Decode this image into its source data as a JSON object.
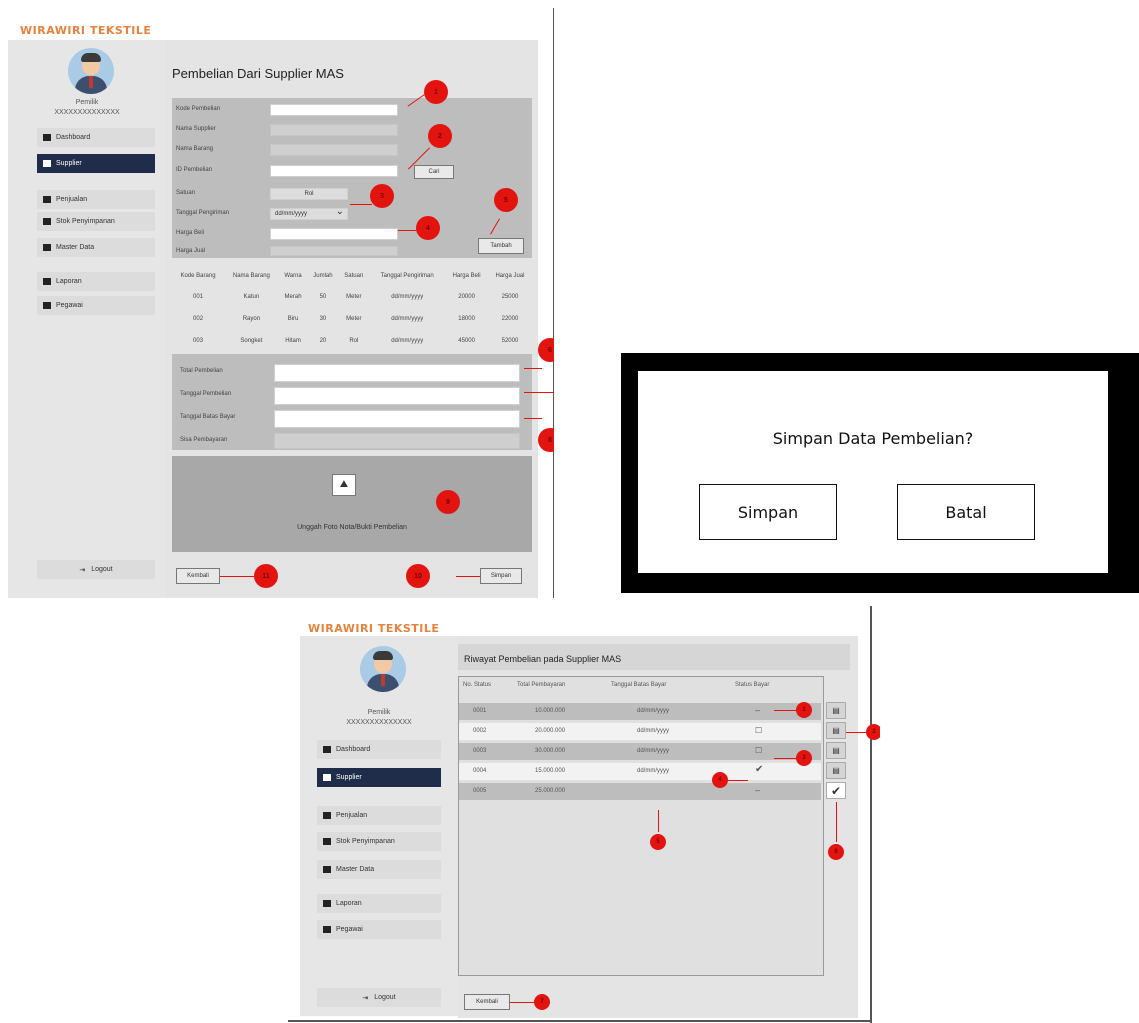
{
  "brand": "WIRAWIRI TEKSTILE",
  "user": {
    "name": "Pemilik",
    "id": "XXXXXXXXXXXXXX"
  },
  "nav": [
    "Dashboard",
    "Supplier",
    "Penjualan",
    "Stok Penyimpanan",
    "Master Data",
    "Laporan",
    "Pegawai"
  ],
  "logout_label": "Logout",
  "form_screen": {
    "title": "Pembelian Dari Supplier MAS",
    "fields": [
      "Kode Pembelian",
      "Nama Supplier",
      "Nama Barang",
      "ID Pembelian",
      "Satuan",
      "Tanggal Pengiriman",
      "Harga Beli",
      "Harga Jual"
    ],
    "cari_label": "Cari",
    "satuan_value": "Rol",
    "date_value": "dd/mm/yyyy",
    "tambah_label": "Tambah",
    "table_headers": [
      "Kode Barang",
      "Nama Barang",
      "Warna",
      "Jumlah",
      "Satuan",
      "Tanggal Pengiriman",
      "Harga Beli",
      "Harga Jual"
    ],
    "table_rows": [
      [
        "001",
        "Katun",
        "Merah",
        "50",
        "Meter",
        "dd/mm/yyyy",
        "20000",
        "25000"
      ],
      [
        "002",
        "Rayon",
        "Biru",
        "30",
        "Meter",
        "dd/mm/yyyy",
        "18000",
        "22000"
      ],
      [
        "003",
        "Songket",
        "Hitam",
        "20",
        "Rol",
        "dd/mm/yyyy",
        "45000",
        "52000"
      ]
    ],
    "payment_fields": [
      "Total Pembelian",
      "Tanggal Pembelian",
      "Tanggal Batas Bayar",
      "Sisa Pembayaran"
    ],
    "upload_label": "Unggah Foto Nota/Bukti Pembelian",
    "kembali_label": "Kembali",
    "simpan_label": "Simpan",
    "badges": [
      "1",
      "2",
      "3",
      "4",
      "5",
      "6",
      "7",
      "8",
      "9",
      "10",
      "11"
    ]
  },
  "dialog": {
    "title": "Simpan Data Pembelian?",
    "simpan_label": "Simpan",
    "batal_label": "Batal"
  },
  "history_screen": {
    "title": "Riwayat Pembelian pada Supplier MAS",
    "headers": [
      "No. Status",
      "Total Pembayaran",
      "Tanggal Batas Bayar",
      "Status Bayar"
    ],
    "rows": [
      [
        "0001",
        "10.000.000",
        "dd/mm/yyyy",
        "–"
      ],
      [
        "0002",
        "20.000.000",
        "dd/mm/yyyy",
        "☐"
      ],
      [
        "0003",
        "30.000.000",
        "dd/mm/yyyy",
        "☐"
      ],
      [
        "0004",
        "15.000.000",
        "dd/mm/yyyy",
        "✔"
      ],
      [
        "0005",
        "25.000.000",
        "",
        "–"
      ]
    ],
    "kembali_label": "Kembali",
    "badges": [
      "1",
      "2",
      "3",
      "4",
      "5",
      "6",
      "7",
      "8"
    ]
  },
  "colors": {
    "brand": "#e8823c",
    "active_nav": "#1f2d4a",
    "badge": "#e3140f"
  }
}
